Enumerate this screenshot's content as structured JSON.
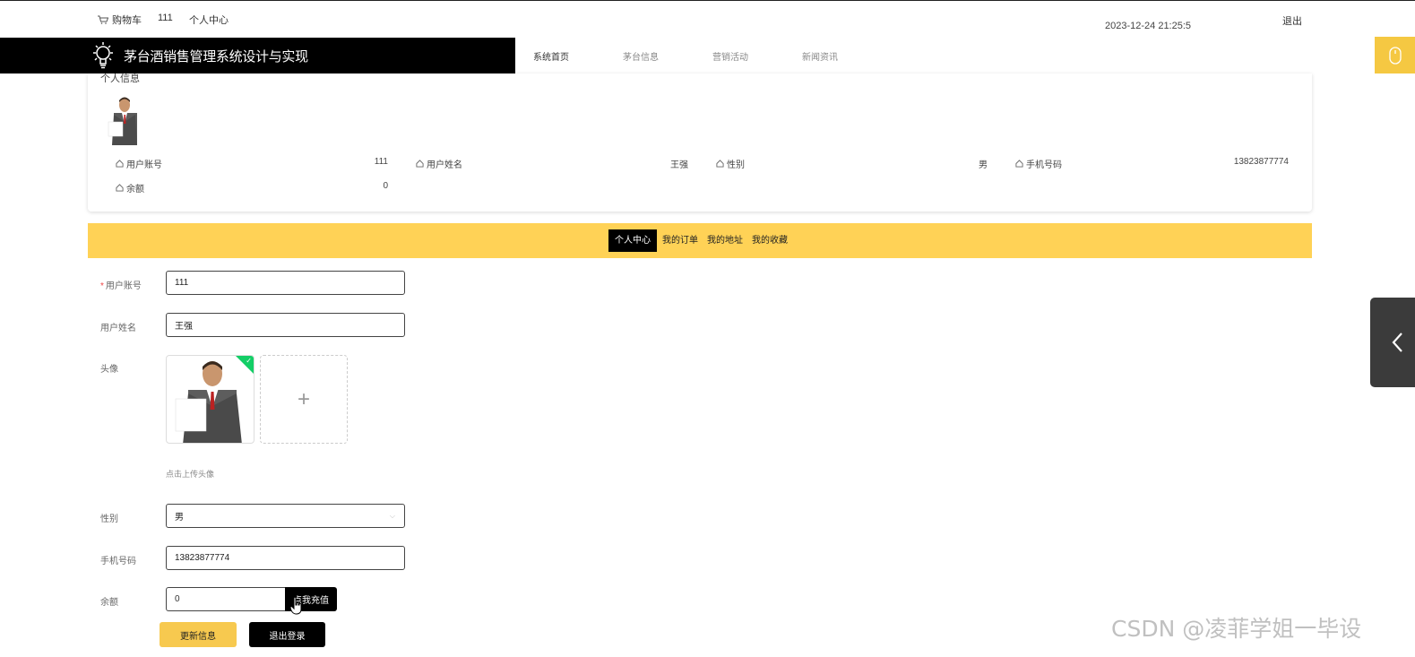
{
  "topbar": {
    "cart_label": "购物车",
    "username": "111",
    "personal_center": "个人中心",
    "datetime": "2023-12-24 21:25:5",
    "logout": "退出"
  },
  "header": {
    "title": "茅台酒销售管理系统设计与实现",
    "nav": [
      "系统首页",
      "茅台信息",
      "营销活动",
      "新闻资讯"
    ]
  },
  "info_card": {
    "title": "个人信息",
    "fields": [
      {
        "label": "用户账号",
        "value": "111"
      },
      {
        "label": "用户姓名",
        "value": "王强"
      },
      {
        "label": "性别",
        "value": "男"
      },
      {
        "label": "手机号码",
        "value": "13823877774"
      },
      {
        "label": "余额",
        "value": "0"
      }
    ]
  },
  "tabs": [
    "个人中心",
    "我的订单",
    "我的地址",
    "我的收藏"
  ],
  "form": {
    "account_label": "用户账号",
    "account_value": "111",
    "name_label": "用户姓名",
    "name_value": "王强",
    "avatar_label": "头像",
    "upload_hint": "点击上传头像",
    "gender_label": "性别",
    "gender_value": "男",
    "phone_label": "手机号码",
    "phone_value": "13823877774",
    "balance_label": "余额",
    "balance_value": "0",
    "recharge_button": "点我充值",
    "update_button": "更新信息",
    "signout_button": "退出登录"
  },
  "watermark": "CSDN @凌菲学姐一毕设",
  "colors": {
    "accent_yellow": "#ffd256",
    "button_yellow": "#f7c94f",
    "dark": "#000000",
    "success_green": "#13ce66"
  }
}
